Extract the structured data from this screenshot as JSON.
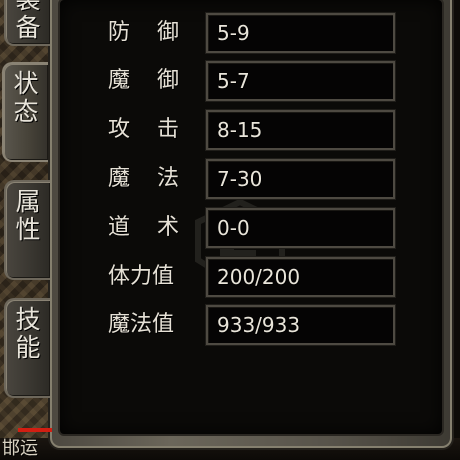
{
  "tabs": [
    {
      "label": "装备"
    },
    {
      "label": "状态"
    },
    {
      "label": "属性"
    },
    {
      "label": "技能"
    }
  ],
  "stats": [
    {
      "label": "防御",
      "value": "5-9"
    },
    {
      "label": "魔御",
      "value": "5-7"
    },
    {
      "label": "攻击",
      "value": "8-15"
    },
    {
      "label": "魔法",
      "value": "7-30"
    },
    {
      "label": "道术",
      "value": "0-0"
    },
    {
      "label": "体力值",
      "value": "200/200"
    },
    {
      "label": "魔法值",
      "value": "933/933"
    }
  ],
  "bottom_text": "邯运",
  "colors": {
    "panel_frame": "#6b665a",
    "value_box": "#050404",
    "text": "#e6e1d6",
    "marker": "#d21e12"
  }
}
